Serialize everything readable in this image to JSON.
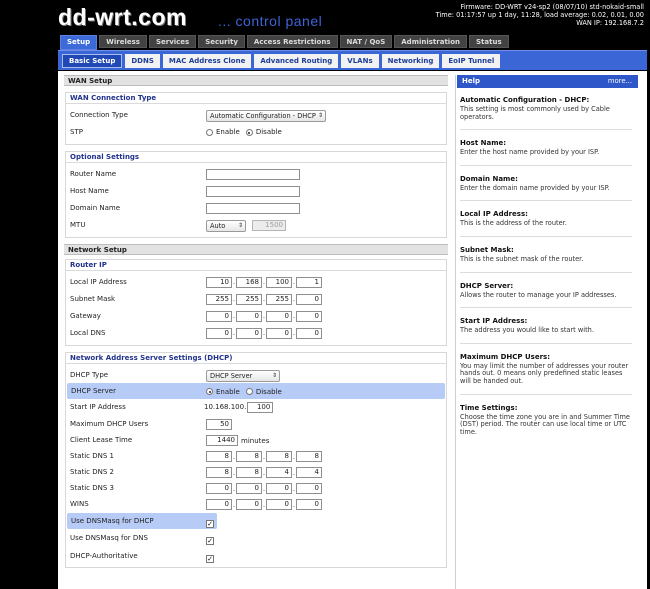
{
  "header": {
    "logo": "dd-wrt.com",
    "subtitle": "... control panel",
    "firmware_line": "Firmware: DD-WRT v24-sp2 (08/07/10) std-nokaid-small",
    "time_line": "Time: 01:17:57 up 1 day, 11:28, load average: 0.02, 0.01, 0.00",
    "wan_ip_line": "WAN IP: 192.168.7.2"
  },
  "main_tabs": [
    "Setup",
    "Wireless",
    "Services",
    "Security",
    "Access Restrictions",
    "NAT / QoS",
    "Administration",
    "Status"
  ],
  "sub_tabs": [
    "Basic Setup",
    "DDNS",
    "MAC Address Clone",
    "Advanced Routing",
    "VLANs",
    "Networking",
    "EoIP Tunnel"
  ],
  "wan": {
    "section_title": "WAN Setup",
    "conn_group_title": "WAN Connection Type",
    "conn_type_label": "Connection Type",
    "conn_type_value": "Automatic Configuration - DHCP",
    "stp_label": "STP",
    "enable": "Enable",
    "disable": "Disable",
    "optional_title": "Optional Settings",
    "router_name_label": "Router Name",
    "host_name_label": "Host Name",
    "domain_name_label": "Domain Name",
    "mtu_label": "MTU",
    "mtu_mode": "Auto",
    "mtu_value": "1500"
  },
  "network": {
    "section_title": "Network Setup",
    "router_ip_title": "Router IP",
    "local_ip_label": "Local IP Address",
    "local_ip": [
      "10",
      "168",
      "100",
      "1"
    ],
    "subnet_label": "Subnet Mask",
    "subnet": [
      "255",
      "255",
      "255",
      "0"
    ],
    "gateway_label": "Gateway",
    "gateway": [
      "0",
      "0",
      "0",
      "0"
    ],
    "local_dns_label": "Local DNS",
    "local_dns": [
      "0",
      "0",
      "0",
      "0"
    ]
  },
  "dhcp": {
    "group_title": "Network Address Server Settings (DHCP)",
    "type_label": "DHCP Type",
    "type_value": "DHCP Server",
    "server_label": "DHCP Server",
    "enable": "Enable",
    "disable": "Disable",
    "start_ip_label": "Start IP Address",
    "start_ip_prefix": "10.168.100.",
    "start_ip_last": "100",
    "max_users_label": "Maximum DHCP Users",
    "max_users": "50",
    "lease_label": "Client Lease Time",
    "lease_value": "1440",
    "lease_unit": "minutes",
    "dns1_label": "Static DNS 1",
    "dns1": [
      "8",
      "8",
      "8",
      "8"
    ],
    "dns2_label": "Static DNS 2",
    "dns2": [
      "8",
      "8",
      "4",
      "4"
    ],
    "dns3_label": "Static DNS 3",
    "dns3": [
      "0",
      "0",
      "0",
      "0"
    ],
    "wins_label": "WINS",
    "wins": [
      "0",
      "0",
      "0",
      "0"
    ],
    "use_dnsmasq_dhcp_label": "Use DNSMasq for DHCP",
    "use_dnsmasq_dns_label": "Use DNSMasq for DNS",
    "authoritative_label": "DHCP-Authoritative",
    "check_mark": "✓"
  },
  "help": {
    "title": "Help",
    "more": "more...",
    "items": [
      {
        "title": "Automatic Configuration - DHCP:",
        "desc": "This setting is most commonly used by Cable operators."
      },
      {
        "title": "Host Name:",
        "desc": "Enter the host name provided by your ISP."
      },
      {
        "title": "Domain Name:",
        "desc": "Enter the domain name provided by your ISP."
      },
      {
        "title": "Local IP Address:",
        "desc": "This is the address of the router."
      },
      {
        "title": "Subnet Mask:",
        "desc": "This is the subnet mask of the router."
      },
      {
        "title": "DHCP Server:",
        "desc": "Allows the router to manage your IP addresses."
      },
      {
        "title": "Start IP Address:",
        "desc": "The address you would like to start with."
      },
      {
        "title": "Maximum DHCP Users:",
        "desc": "You may limit the number of addresses your router hands out. 0 means only predefined static leases will be handed out."
      },
      {
        "title": "Time Settings:",
        "desc": "Choose the time zone you are in and Summer Time (DST) period. The router can use local time or UTC time."
      }
    ]
  }
}
